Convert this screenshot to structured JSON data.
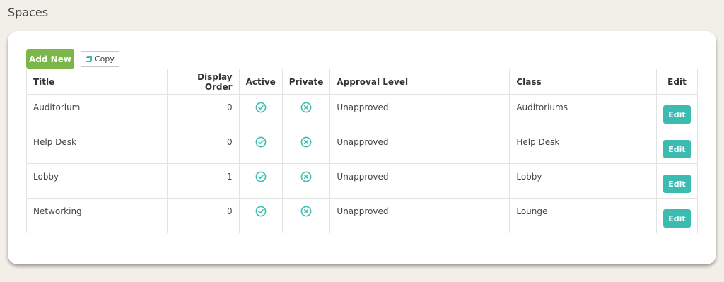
{
  "page": {
    "title": "Spaces"
  },
  "toolbar": {
    "add_new_label": "Add New",
    "copy_label": "Copy"
  },
  "colors": {
    "background": "#f2efe9",
    "add_button": "#7ab648",
    "edit_button": "#3cbcb0",
    "status_icon": "#3cbcb0"
  },
  "table": {
    "headers": {
      "title": "Title",
      "display_order": "Display Order",
      "active": "Active",
      "private": "Private",
      "approval_level": "Approval Level",
      "class": "Class",
      "edit": "Edit"
    },
    "rows": [
      {
        "title": "Auditorium",
        "display_order": "0",
        "active_icon": "check-circle-icon",
        "private_icon": "x-circle-icon",
        "approval_level": "Unapproved",
        "class": "Auditoriums",
        "edit_label": "Edit"
      },
      {
        "title": "Help Desk",
        "display_order": "0",
        "active_icon": "check-circle-icon",
        "private_icon": "x-circle-icon",
        "approval_level": "Unapproved",
        "class": "Help Desk",
        "edit_label": "Edit"
      },
      {
        "title": "Lobby",
        "display_order": "1",
        "active_icon": "check-circle-icon",
        "private_icon": "x-circle-icon",
        "approval_level": "Unapproved",
        "class": "Lobby",
        "edit_label": "Edit"
      },
      {
        "title": "Networking",
        "display_order": "0",
        "active_icon": "check-circle-icon",
        "private_icon": "x-circle-icon",
        "approval_level": "Unapproved",
        "class": "Lounge",
        "edit_label": "Edit"
      }
    ]
  }
}
